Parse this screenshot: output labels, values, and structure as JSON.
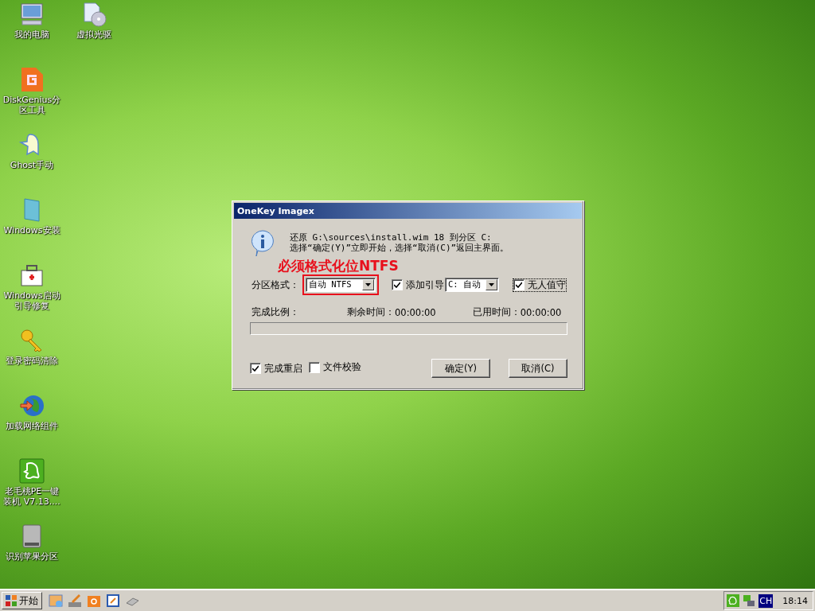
{
  "desktop_icons": [
    {
      "label": "我的电脑",
      "kind": "computer"
    },
    {
      "label": "虚拟光驱",
      "kind": "disc"
    },
    {
      "label": "DiskGenius分区工具",
      "kind": "diskgenius"
    },
    {
      "label": "Ghost手动",
      "kind": "ghost"
    },
    {
      "label": "Windows安装",
      "kind": "windows"
    },
    {
      "label": "Windows启动引导修复",
      "kind": "repair"
    },
    {
      "label": "登录密码清除",
      "kind": "key"
    },
    {
      "label": "加载网络组件",
      "kind": "globe"
    },
    {
      "label": "老毛桃PE一键装机 V7.13....",
      "kind": "pe"
    },
    {
      "label": "识别苹果分区",
      "kind": "drive"
    }
  ],
  "dialog": {
    "title": "OneKey Imagex",
    "message": [
      "还原 G:\\sources\\install.wim 18 到分区 C:",
      "选择“确定(Y)”立即开始，选择“取消(C)”返回主界面。"
    ],
    "annotation": "必须格式化位NTFS",
    "format_label": "分区格式：",
    "format_value": "自动 NTFS",
    "add_boot": {
      "label": "添加引导",
      "checked": true
    },
    "boot_value": "C: 自动",
    "unattended": {
      "label": "无人值守",
      "checked": true
    },
    "progress_label": "完成比例：",
    "remaining_label": "剩余时间：",
    "remaining_value": "00:00:00",
    "elapsed_label": "已用时间：",
    "elapsed_value": "00:00:00",
    "progress": {
      "level": 0
    },
    "options": [
      {
        "label": "完成重启",
        "checked": true
      },
      {
        "label": "文件校验",
        "checked": false
      }
    ],
    "buttons": [
      "确定(Y)",
      "取消(C)"
    ]
  },
  "taskbar": {
    "start": "开始",
    "language": "CH",
    "clock": "18:14"
  }
}
